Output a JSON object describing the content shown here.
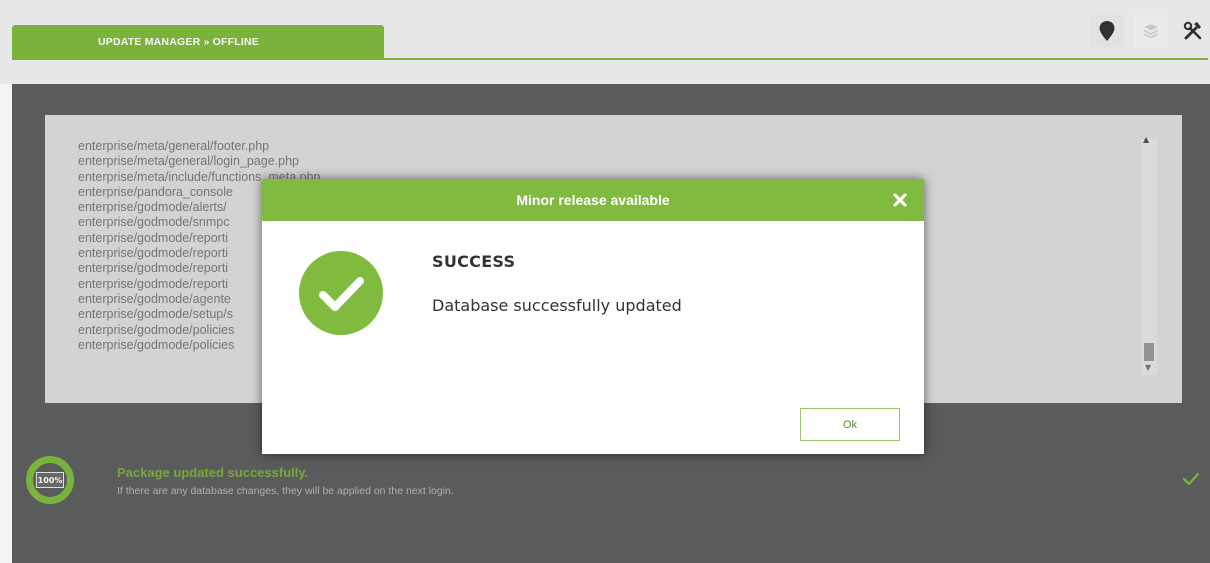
{
  "header": {
    "tab_label": "UPDATE MANAGER » OFFLINE",
    "icons": [
      "location-pin-icon",
      "stack-icon",
      "tools-icon"
    ]
  },
  "files": [
    "enterprise/meta/general/footer.php",
    "enterprise/meta/general/login_page.php",
    "enterprise/meta/include/functions_meta.php",
    "enterprise/pandora_console",
    "enterprise/godmode/alerts/",
    "enterprise/godmode/snmpc",
    "enterprise/godmode/reporti",
    "enterprise/godmode/reporti",
    "enterprise/godmode/reporti",
    "enterprise/godmode/reporti",
    "enterprise/godmode/agente",
    "enterprise/godmode/setup/s",
    "enterprise/godmode/policies",
    "enterprise/godmode/policies"
  ],
  "progress": {
    "label": "100%",
    "value": 100
  },
  "status": {
    "title": "Package updated successfully.",
    "subtitle": "If there are any database changes, they will be applied on the next login."
  },
  "dialog": {
    "title": "Minor release available",
    "heading": "SUCCESS",
    "message": "Database successfully updated",
    "ok_label": "Ok"
  },
  "colors": {
    "accent": "#80ba3f",
    "panel": "#5d5f60",
    "filebox": "#dcdcdc"
  }
}
